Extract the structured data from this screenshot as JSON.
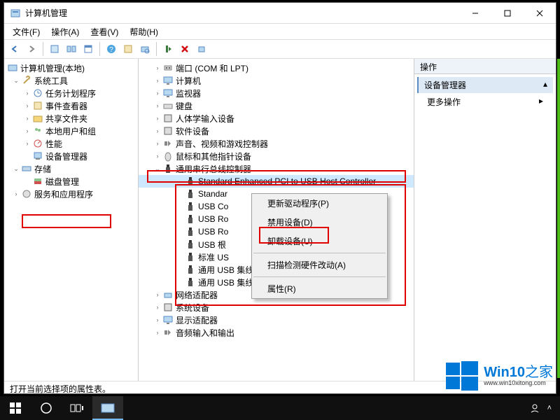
{
  "window": {
    "title": "计算机管理"
  },
  "menubar": [
    "文件(F)",
    "操作(A)",
    "查看(V)",
    "帮助(H)"
  ],
  "leftTree": {
    "root": "计算机管理(本地)",
    "systools": "系统工具",
    "systools_children": [
      "任务计划程序",
      "事件查看器",
      "共享文件夹",
      "本地用户和组",
      "性能",
      "设备管理器"
    ],
    "storage": "存储",
    "storage_children": [
      "磁盘管理"
    ],
    "services": "服务和应用程序"
  },
  "deviceTree": {
    "ports": "端口 (COM 和 LPT)",
    "computer": "计算机",
    "monitor": "监视器",
    "keyboard": "键盘",
    "hid": "人体学输入设备",
    "software": "软件设备",
    "audio": "声音、视频和游戏控制器",
    "mouse": "鼠标和其他指针设备",
    "usb": "通用串行总线控制器",
    "usb_children": [
      "Standard Enhanced PCI to USB Host Controller",
      "Standard Enhanced PCI to USB Host Controller",
      "USB Composite Device",
      "USB Root Hub",
      "USB Root Hub",
      "USB 根集线器",
      "标准 USB 主控制器(Microsoft)",
      "通用 USB 集线器",
      "通用 USB 集线器"
    ],
    "usb_children_cut": [
      "Standard Enhanced PCI to USB Host Controller",
      "Standar",
      "USB Co",
      "USB Ro",
      "USB Ro",
      "USB 根",
      "标准 US",
      "通用 USB 集线器",
      "通用 USB 集线器"
    ],
    "network": "网络适配器",
    "system": "系统设备",
    "display": "显示适配器",
    "soundio": "音频输入和输出"
  },
  "contextMenu": {
    "update": "更新驱动程序(P)",
    "disable": "禁用设备(D)",
    "uninstall": "卸载设备(U)",
    "scan": "扫描检测硬件改动(A)",
    "properties": "属性(R)"
  },
  "actions": {
    "header": "操作",
    "title": "设备管理器",
    "more": "更多操作"
  },
  "statusbar": "打开当前选择项的属性表。",
  "watermark": {
    "brand": "Win10",
    "suffix": "之家",
    "url": "www.win10xitong.com"
  }
}
